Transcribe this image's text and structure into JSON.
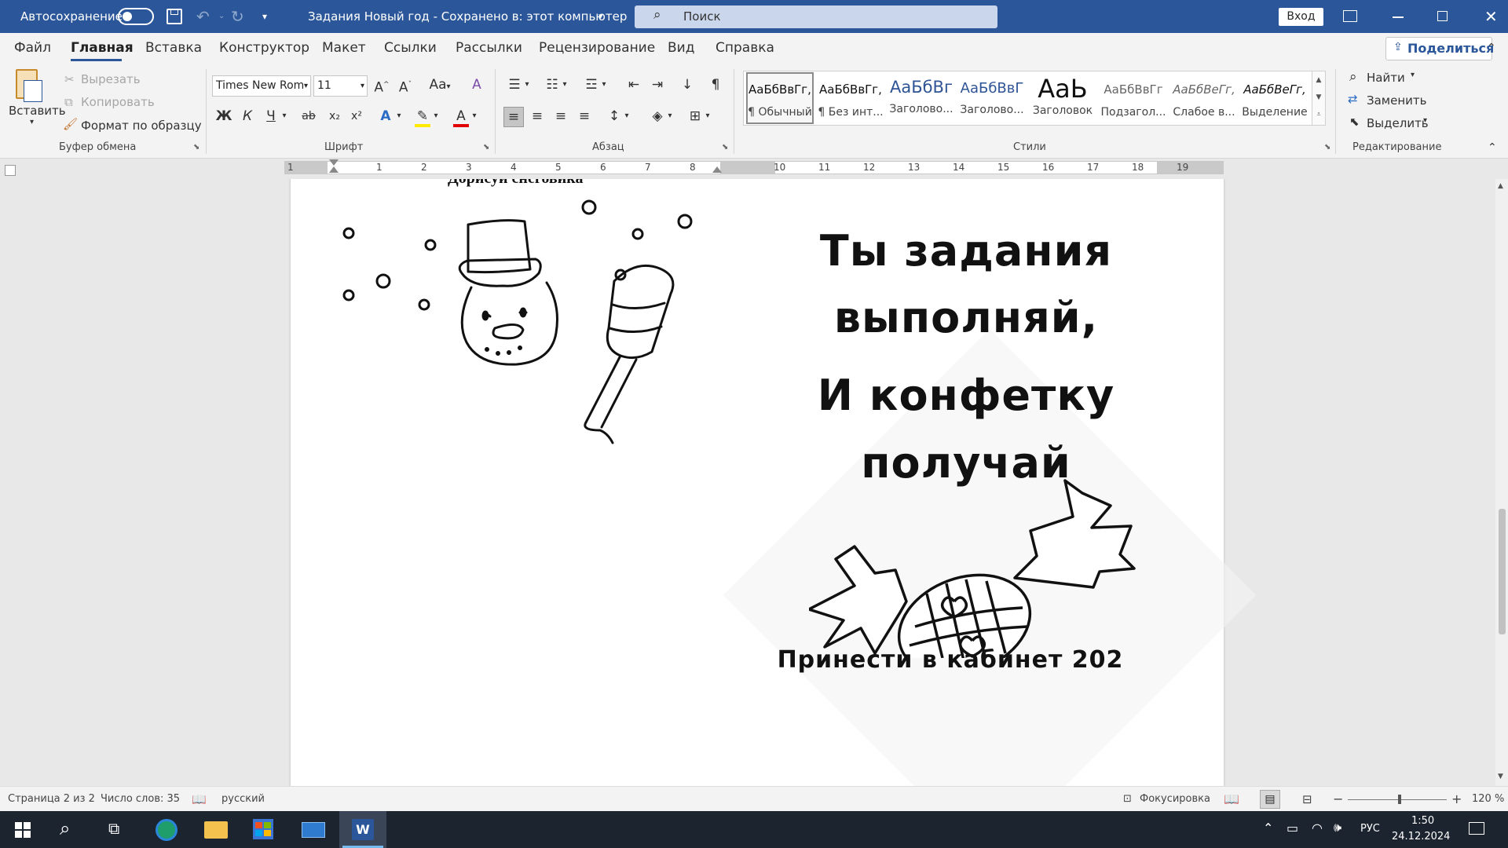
{
  "titlebar": {
    "autosave_label": "Автосохранение",
    "doc_title": "Задания Новый год  -  Сохранено в: этот компьютер",
    "search_placeholder": "Поиск",
    "signin_label": "Вход"
  },
  "menu": {
    "tabs": [
      "Файл",
      "Главная",
      "Вставка",
      "Конструктор",
      "Макет",
      "Ссылки",
      "Рассылки",
      "Рецензирование",
      "Вид",
      "Справка"
    ],
    "share_label": "Поделиться"
  },
  "ribbon": {
    "clipboard": {
      "paste": "Вставить",
      "cut": "Вырезать",
      "copy": "Копировать",
      "format_painter": "Формат по образцу",
      "group": "Буфер обмена"
    },
    "font": {
      "name": "Times New Rom",
      "size": "11",
      "bold": "Ж",
      "italic": "К",
      "underline": "Ч",
      "group": "Шрифт",
      "grow": "A^",
      "shrink": "Aˇ",
      "case": "Aa",
      "subscript": "x₂",
      "superscript": "x²",
      "strike": "ab"
    },
    "paragraph": {
      "group": "Абзац",
      "pilcrow": "¶"
    },
    "styles": {
      "group": "Стили",
      "items": [
        {
          "preview": "АаБбВвГг,",
          "name": "¶ Обычный"
        },
        {
          "preview": "АаБбВвГг,",
          "name": "¶ Без инт..."
        },
        {
          "preview": "АаБбВг",
          "name": "Заголово..."
        },
        {
          "preview": "АаБбВвГ",
          "name": "Заголово..."
        },
        {
          "preview": "АаЬ",
          "name": "Заголовок"
        },
        {
          "preview": "АаБбВвГг",
          "name": "Подзагол..."
        },
        {
          "preview": "АаБбВеГг,",
          "name": "Слабое в..."
        },
        {
          "preview": "АаБбВеГг,",
          "name": "Выделение"
        }
      ]
    },
    "editing": {
      "find": "Найти",
      "replace": "Заменить",
      "select": "Выделить",
      "group": "Редактирование"
    }
  },
  "ruler": {
    "numbers": [
      "1",
      "1",
      "2",
      "3",
      "4",
      "5",
      "6",
      "7",
      "8",
      "10",
      "11",
      "12",
      "13",
      "14",
      "15",
      "16",
      "17",
      "18",
      "19"
    ]
  },
  "document": {
    "heading": "Дорисуй снеговика",
    "poem": [
      "Ты задания",
      "выполняй,",
      "И конфетку",
      "получай"
    ],
    "footer_note": "Принести в кабинет 202"
  },
  "status": {
    "page": "Страница 2 из 2",
    "words": "Число слов: 35",
    "language": "русский",
    "focus": "Фокусировка",
    "zoom": "120 %"
  },
  "taskbar": {
    "lang": "РУС",
    "time": "1:50",
    "date": "24.12.2024"
  }
}
